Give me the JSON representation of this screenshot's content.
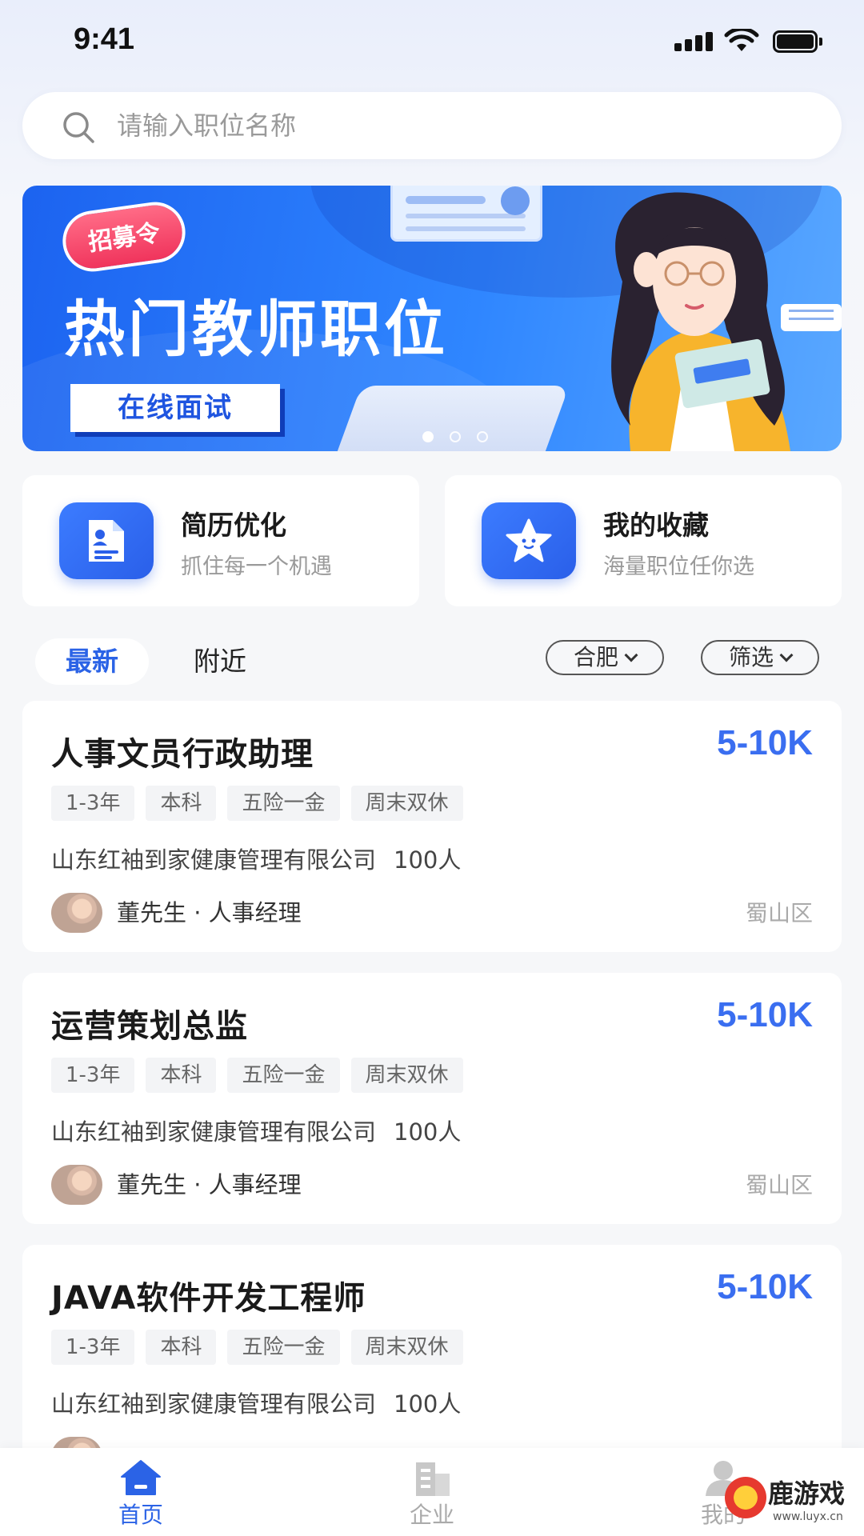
{
  "status_bar": {
    "time": "9:41"
  },
  "search": {
    "placeholder": "请输入职位名称",
    "value": ""
  },
  "banner": {
    "tag": "招募令",
    "title": "热门教师职位",
    "button": "在线面试",
    "carousel": {
      "pages": 3,
      "active": 1
    }
  },
  "quick_actions": [
    {
      "title": "简历优化",
      "subtitle": "抓住每一个机遇",
      "icon": "resume-icon"
    },
    {
      "title": "我的收藏",
      "subtitle": "海量职位任你选",
      "icon": "star-icon"
    }
  ],
  "filters": {
    "tabs": [
      "最新",
      "附近"
    ],
    "active_tab": "最新",
    "city": "合肥",
    "filter": "筛选"
  },
  "jobs": [
    {
      "title": "人事文员行政助理",
      "salary": "5-10K",
      "tags": [
        "1-3年",
        "本科",
        "五险一金",
        "周末双休"
      ],
      "company": "山东红袖到家健康管理有限公司",
      "company_size": "100人",
      "contact": "董先生 · 人事经理",
      "location": "蜀山区"
    },
    {
      "title": "运营策划总监",
      "salary": "5-10K",
      "tags": [
        "1-3年",
        "本科",
        "五险一金",
        "周末双休"
      ],
      "company": "山东红袖到家健康管理有限公司",
      "company_size": "100人",
      "contact": "董先生 · 人事经理",
      "location": "蜀山区"
    },
    {
      "title": "JAVA软件开发工程师",
      "salary": "5-10K",
      "tags": [
        "1-3年",
        "本科",
        "五险一金",
        "周末双休"
      ],
      "company": "山东红袖到家健康管理有限公司",
      "company_size": "100人",
      "contact": "",
      "location": ""
    }
  ],
  "bottom_nav": [
    {
      "label": "首页",
      "icon": "home-icon",
      "active": true
    },
    {
      "label": "企业",
      "icon": "building-icon",
      "active": false
    },
    {
      "label": "我的",
      "icon": "user-icon",
      "active": false
    }
  ],
  "watermark": {
    "text": "鹿游戏",
    "url": "www.luyx.cn"
  },
  "colors": {
    "accent": "#2b63e6",
    "salary": "#3a6ef0",
    "banner": "#1c63f0"
  }
}
